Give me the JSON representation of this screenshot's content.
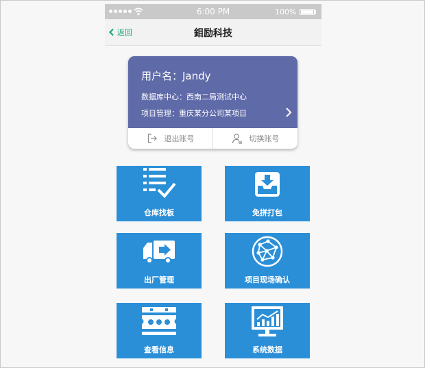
{
  "status_bar": {
    "time": "6:00 PM",
    "battery": "100%",
    "battery_level": 1.0
  },
  "nav": {
    "back_label": "返回",
    "title": "鉬励科技"
  },
  "user_card": {
    "username": "用户名：Jandy",
    "data_center": "数据库中心：西南二局测试中心",
    "project": "项目管理：重庆某分公司某项目",
    "logout_label": "退出账号",
    "switch_label": "切换账号"
  },
  "tiles": [
    {
      "label": "仓库找板",
      "icon": "checklist-icon"
    },
    {
      "label": "免拼打包",
      "icon": "inbox-download-icon"
    },
    {
      "label": "出厂管理",
      "icon": "delivery-truck-icon"
    },
    {
      "label": "项目现场确认",
      "icon": "network-globe-icon"
    },
    {
      "label": "查看信息",
      "icon": "info-panel-icon"
    },
    {
      "label": "系统数据",
      "icon": "monitor-chart-icon"
    }
  ],
  "colors": {
    "status_bar": "#c9c9c9",
    "accent_green": "#1fa67a",
    "card": "#5f6aa8",
    "tile": "#2b8fd8"
  }
}
